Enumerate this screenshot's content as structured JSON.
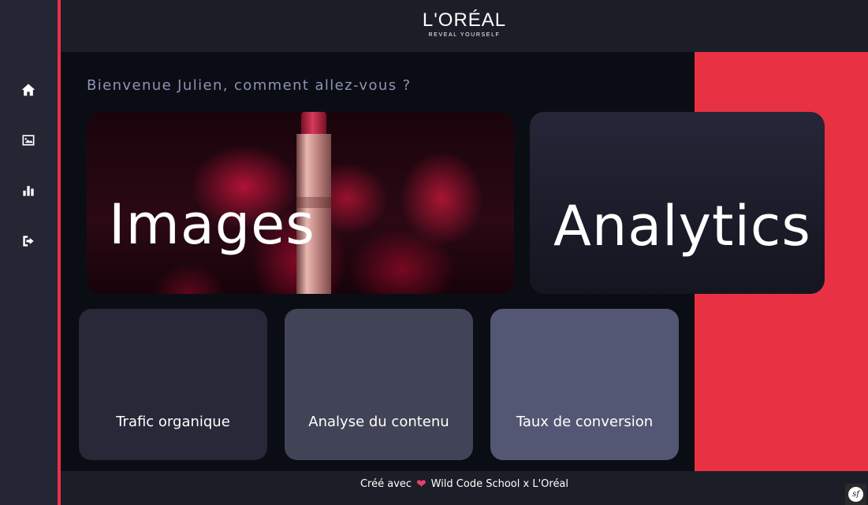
{
  "brand": {
    "name": "L'ORÉAL",
    "tagline": "REVEAL YOURSELF"
  },
  "sidebar": {
    "items": [
      {
        "icon": "home-icon"
      },
      {
        "icon": "image-icon"
      },
      {
        "icon": "bar-chart-icon"
      },
      {
        "icon": "logout-icon"
      }
    ]
  },
  "main": {
    "welcome": "Bienvenue Julien, comment allez-vous ?",
    "cards": {
      "images": "Images",
      "analytics": "Analytics"
    },
    "metrics": [
      {
        "label": "Trafic organique"
      },
      {
        "label": "Analyse du contenu"
      },
      {
        "label": "Taux de conversion"
      }
    ]
  },
  "footer": {
    "prefix": "Créé avec",
    "suffix": "Wild Code School x L'Oréal"
  },
  "debug_badge": {
    "label": "sf"
  },
  "colors": {
    "accent": "#e83244",
    "sidebar": "#252634",
    "header": "#1c1e27",
    "background": "#0b0d14",
    "welcome_text": "#8f93b3",
    "metric_1": "#272838",
    "metric_2": "#414356",
    "metric_3": "#545774"
  }
}
